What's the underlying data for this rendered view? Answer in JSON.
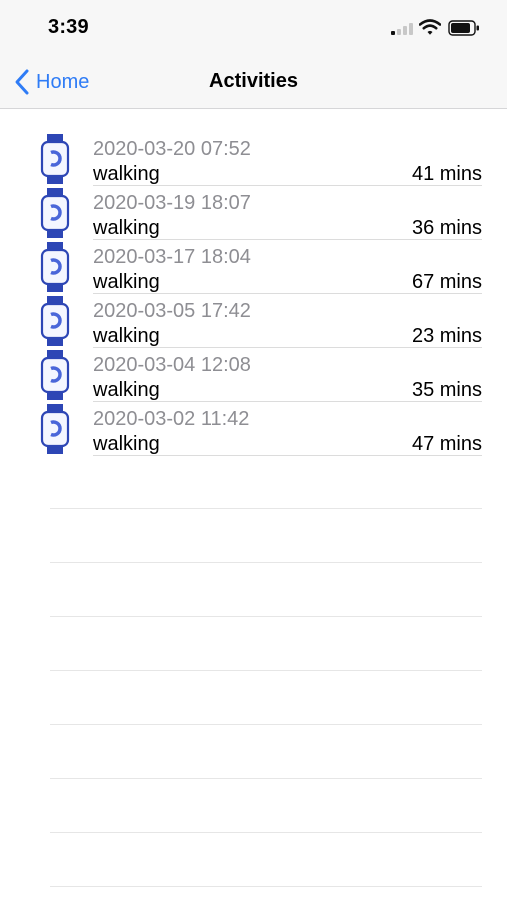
{
  "status_bar": {
    "time": "3:39"
  },
  "nav": {
    "back_label": "Home",
    "title": "Activities"
  },
  "activities": [
    {
      "date": "2020-03-20 07:52",
      "type": "walking",
      "duration": "41 mins"
    },
    {
      "date": "2020-03-19 18:07",
      "type": "walking",
      "duration": "36 mins"
    },
    {
      "date": "2020-03-17 18:04",
      "type": "walking",
      "duration": "67 mins"
    },
    {
      "date": "2020-03-05 17:42",
      "type": "walking",
      "duration": "23 mins"
    },
    {
      "date": "2020-03-04 12:08",
      "type": "walking",
      "duration": "35 mins"
    },
    {
      "date": "2020-03-02 11:42",
      "type": "walking",
      "duration": "47 mins"
    }
  ],
  "icons": {
    "row_icon": "watch-icon",
    "back_icon": "chevron-left-icon",
    "status_icons": [
      "signal-icon",
      "wifi-icon",
      "battery-icon"
    ]
  },
  "colors": {
    "accent": "#2f7cf6",
    "watch_band": "#2d46b5",
    "secondary_text": "#8e8e93"
  }
}
